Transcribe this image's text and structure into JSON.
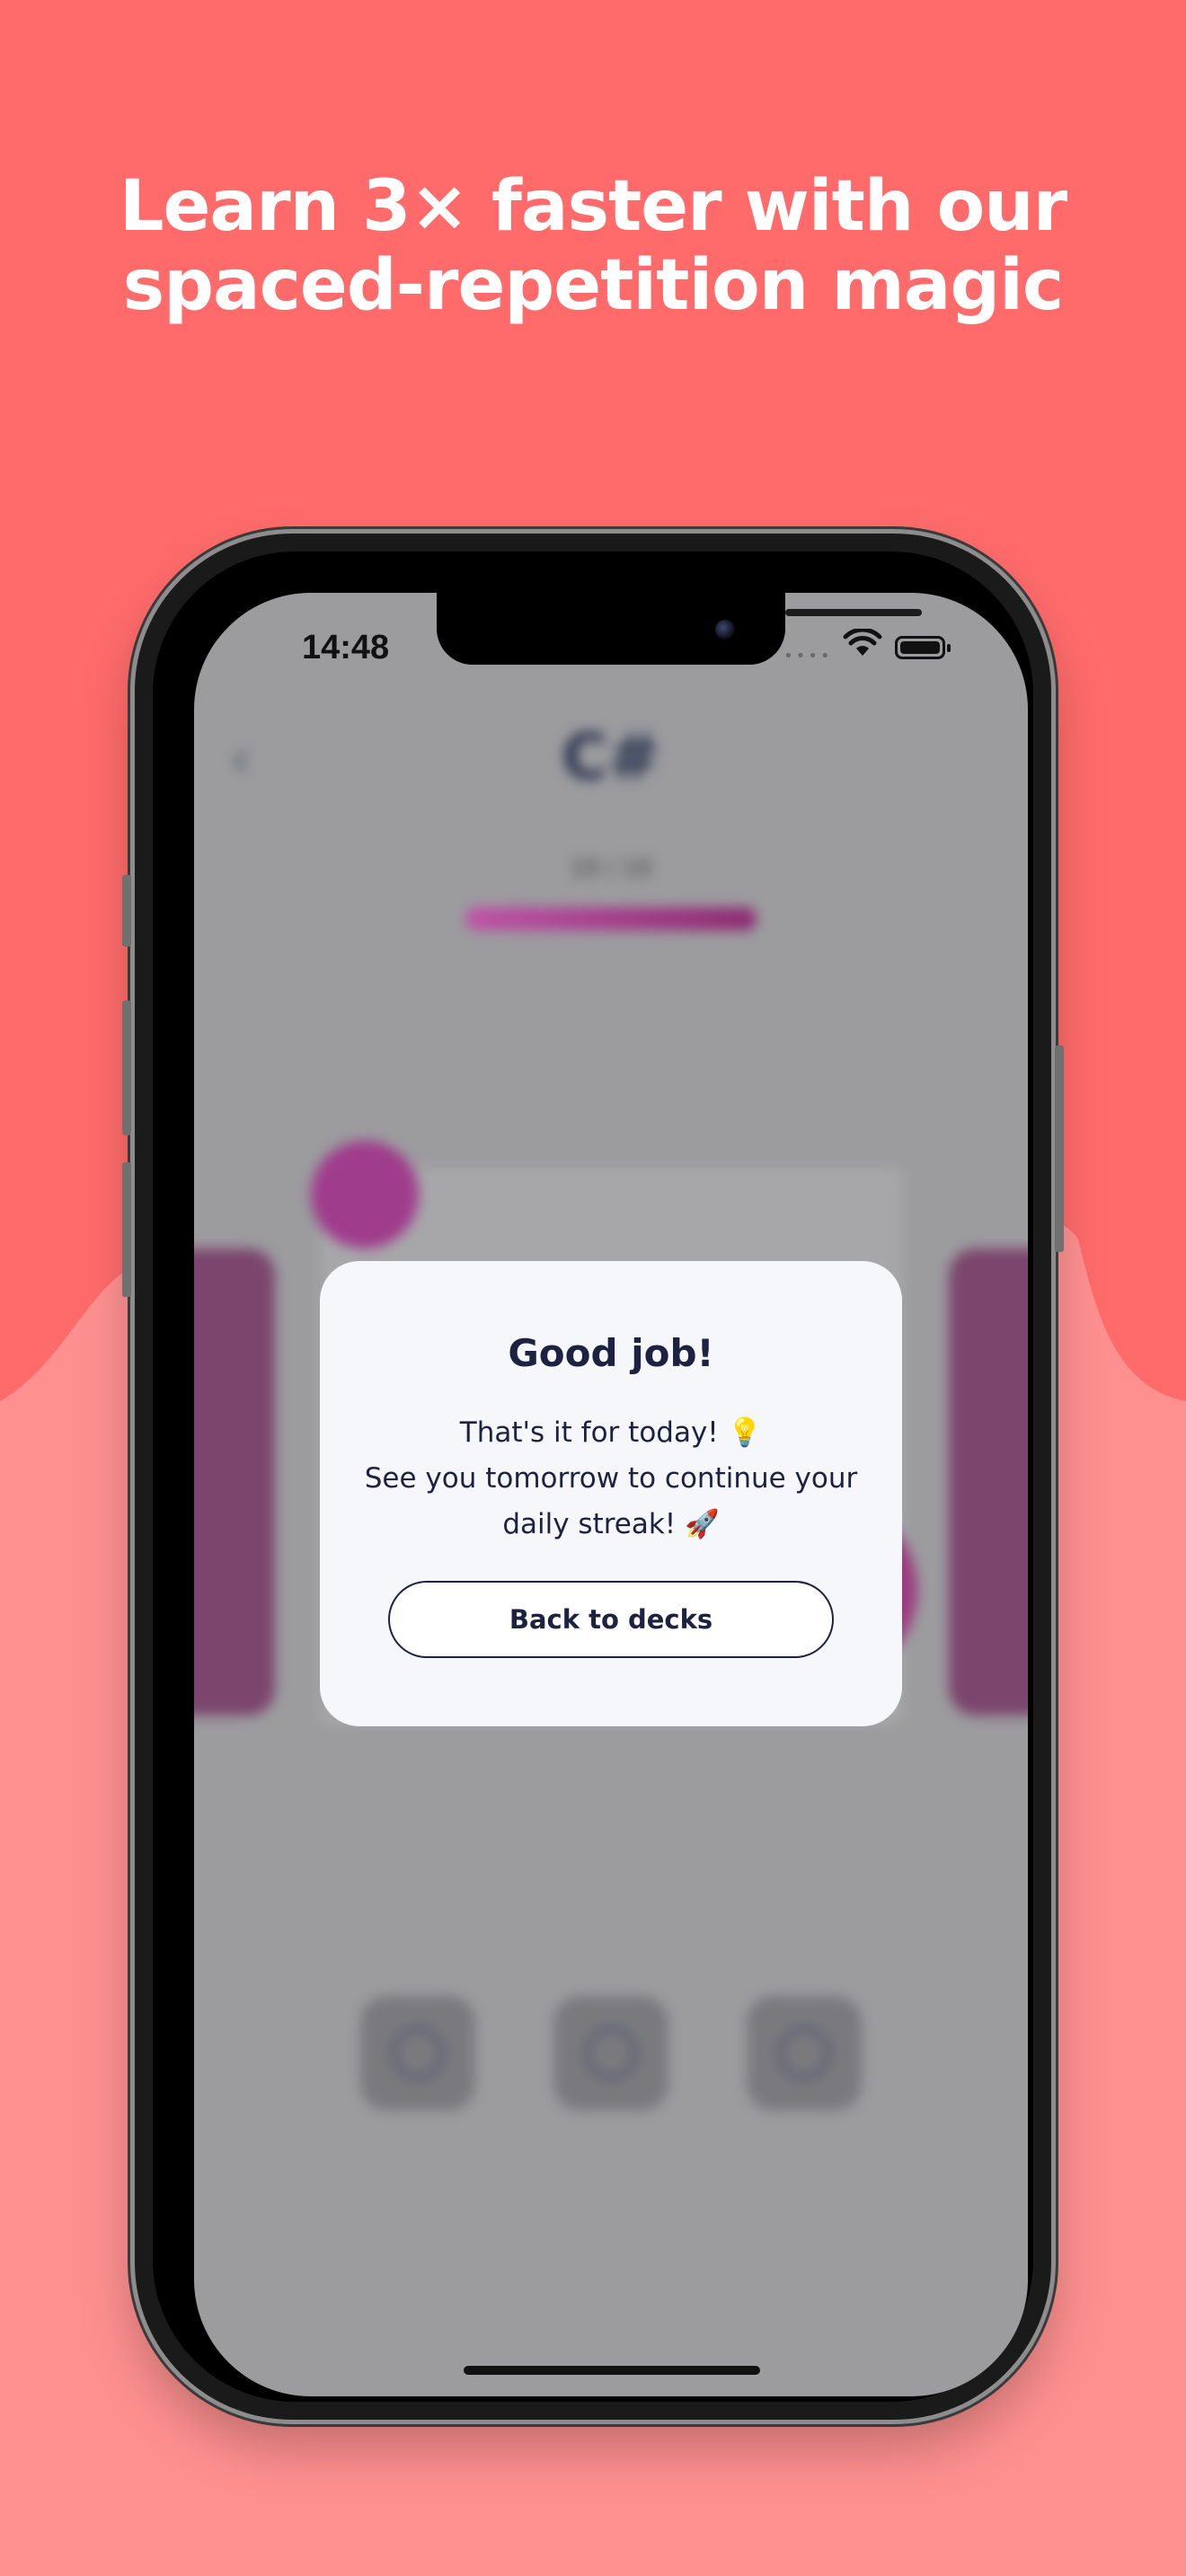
{
  "headline": {
    "line1": "Learn 3× faster with our",
    "line2": "spaced-repetition magic"
  },
  "colors": {
    "background_top": "#FF6B6B",
    "background_bottom": "#FF9090",
    "modal_background": "#F5F7FB",
    "text_dark": "#1C2240",
    "accent": "#A03C8C"
  },
  "status_bar": {
    "time": "14:48"
  },
  "app": {
    "deck_title": "C#",
    "progress_text": "10 / 10"
  },
  "modal": {
    "title": "Good job!",
    "line1": "That's it for today! 💡",
    "line2": "See you tomorrow to continue your",
    "line3": "daily streak! 🚀",
    "button_label": "Back to decks"
  },
  "icons": [
    "back-chevron-icon",
    "wifi-icon",
    "battery-icon",
    "lightbulb-icon",
    "rocket-icon"
  ]
}
